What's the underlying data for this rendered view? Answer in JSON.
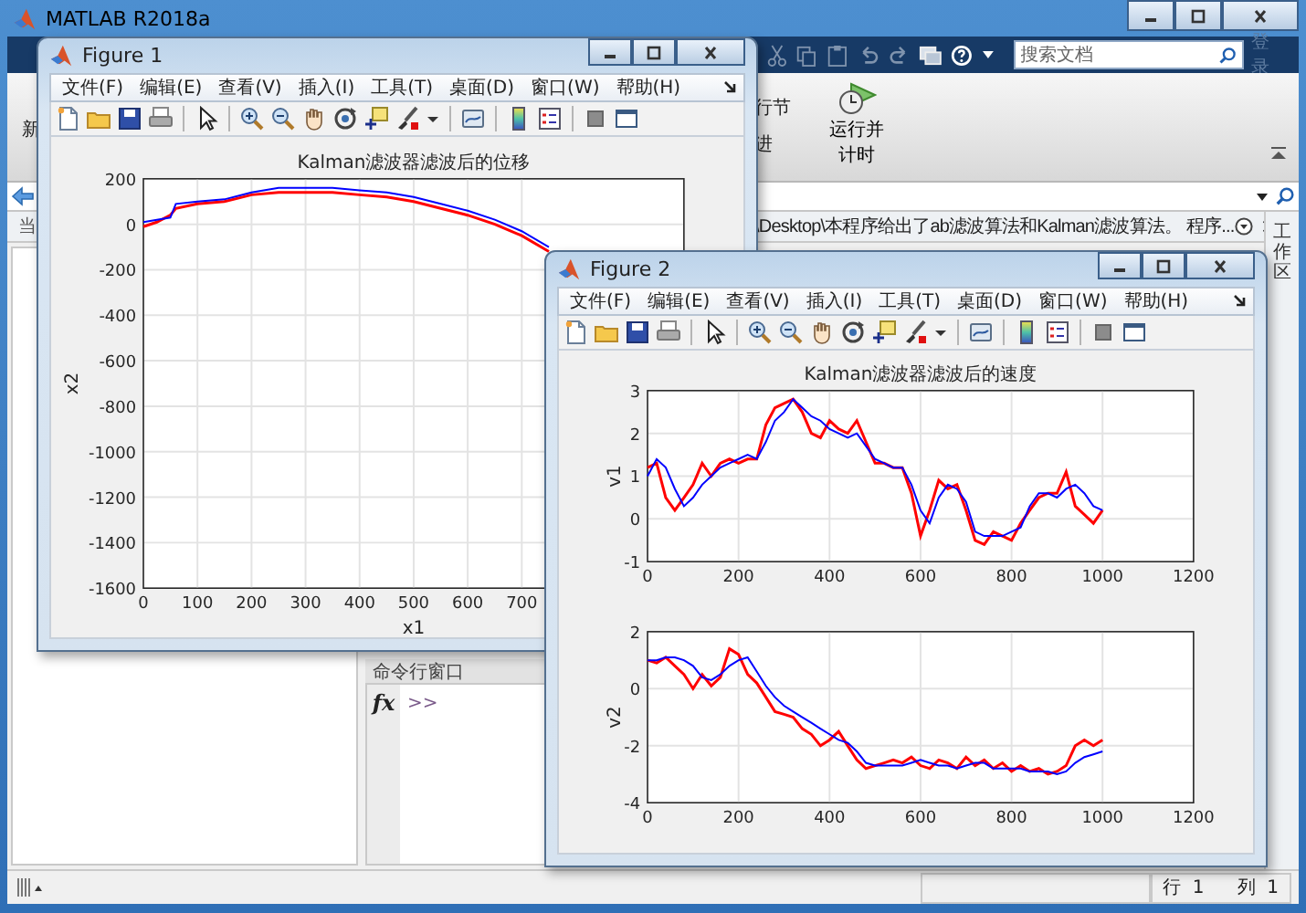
{
  "main_window": {
    "title": "MATLAB R2018a"
  },
  "quick_access": {
    "search": {
      "placeholder": "搜索文档"
    },
    "sign_in": "登录"
  },
  "ribbon": {
    "left_label": "新",
    "section_labels": [
      "行节",
      "进"
    ],
    "run_and_time": [
      "运行并",
      "计时"
    ]
  },
  "current_folder": {
    "label": "当",
    "path": "\\Desktop\\本程序给出了ab滤波算法和Kalman滤波算法。 程序..."
  },
  "workspace_panel": {
    "title": "工作区"
  },
  "command_window": {
    "title": "命令行窗口",
    "function_hint": "fx",
    "prompt": ">>"
  },
  "status_bar": [
    {
      "label": "行",
      "value": "1"
    },
    {
      "label": "列",
      "value": "1"
    }
  ],
  "figures": [
    {
      "title": "Figure 1",
      "menu": [
        "文件(F)",
        "编辑(E)",
        "查看(V)",
        "插入(I)",
        "工具(T)",
        "桌面(D)",
        "窗口(W)",
        "帮助(H)"
      ],
      "axes": [
        {
          "chart_data": {
            "type": "line",
            "title": "Kalman滤波器滤波后的位移",
            "xlabel": "x1",
            "ylabel": "x2",
            "x": [
              0,
              25,
              50,
              60,
              100,
              150,
              200,
              250,
              300,
              350,
              400,
              450,
              500,
              550,
              600,
              650,
              700,
              750
            ],
            "series": [
              {
                "color": "#ff0000",
                "values": [
                  -10,
                  10,
                  40,
                  70,
                  90,
                  100,
                  130,
                  140,
                  140,
                  140,
                  130,
                  120,
                  100,
                  70,
                  40,
                  0,
                  -50,
                  -120
                ]
              },
              {
                "color": "#0000ff",
                "values": [
                  10,
                  20,
                  30,
                  90,
                  100,
                  110,
                  140,
                  160,
                  160,
                  160,
                  150,
                  140,
                  120,
                  90,
                  60,
                  20,
                  -30,
                  -100
                ]
              }
            ],
            "grid": true,
            "xlim": [
              0,
              1000
            ],
            "ylim": [
              -1600,
              200
            ],
            "xticks": [
              0,
              100,
              200,
              300,
              400,
              500,
              600,
              700
            ],
            "yticks": [
              -1600,
              -1400,
              -1200,
              -1000,
              -800,
              -600,
              -400,
              -200,
              0,
              200
            ]
          }
        }
      ]
    },
    {
      "title": "Figure 2",
      "menu": [
        "文件(F)",
        "编辑(E)",
        "查看(V)",
        "插入(I)",
        "工具(T)",
        "桌面(D)",
        "窗口(W)",
        "帮助(H)"
      ],
      "axes": [
        {
          "chart_data": {
            "type": "line",
            "title": "Kalman滤波器滤波后的速度",
            "ylabel": "v1",
            "x": [
              0,
              20,
              40,
              60,
              80,
              100,
              120,
              140,
              160,
              180,
              200,
              220,
              240,
              260,
              280,
              300,
              320,
              340,
              360,
              380,
              400,
              420,
              440,
              460,
              480,
              500,
              520,
              540,
              560,
              580,
              600,
              620,
              640,
              660,
              680,
              700,
              720,
              740,
              760,
              780,
              800,
              820,
              840,
              860,
              880,
              900,
              920,
              940,
              960,
              980,
              1000
            ],
            "series": [
              {
                "color": "#ff0000",
                "values": [
                  1.2,
                  1.3,
                  0.5,
                  0.2,
                  0.5,
                  0.8,
                  1.3,
                  1.0,
                  1.3,
                  1.4,
                  1.3,
                  1.4,
                  1.4,
                  2.2,
                  2.6,
                  2.7,
                  2.8,
                  2.5,
                  2.0,
                  1.9,
                  2.3,
                  2.1,
                  2.0,
                  2.3,
                  1.8,
                  1.3,
                  1.3,
                  1.2,
                  1.2,
                  0.6,
                  -0.4,
                  0.2,
                  0.9,
                  0.7,
                  0.8,
                  0.2,
                  -0.5,
                  -0.6,
                  -0.3,
                  -0.4,
                  -0.5,
                  -0.1,
                  0.2,
                  0.5,
                  0.6,
                  0.6,
                  1.1,
                  0.3,
                  0.1,
                  -0.1,
                  0.2
                ]
              },
              {
                "color": "#0000ff",
                "values": [
                  1.0,
                  1.4,
                  1.2,
                  0.7,
                  0.3,
                  0.5,
                  0.8,
                  1.0,
                  1.2,
                  1.3,
                  1.4,
                  1.5,
                  1.4,
                  1.8,
                  2.3,
                  2.5,
                  2.8,
                  2.6,
                  2.4,
                  2.3,
                  2.1,
                  2.0,
                  1.9,
                  2.0,
                  1.7,
                  1.4,
                  1.3,
                  1.2,
                  1.2,
                  0.8,
                  0.2,
                  -0.1,
                  0.5,
                  0.8,
                  0.7,
                  0.4,
                  -0.3,
                  -0.4,
                  -0.4,
                  -0.4,
                  -0.3,
                  -0.2,
                  0.3,
                  0.6,
                  0.6,
                  0.5,
                  0.7,
                  0.8,
                  0.6,
                  0.3,
                  0.2
                ]
              }
            ],
            "grid": true,
            "xlim": [
              0,
              1200
            ],
            "ylim": [
              -1,
              3
            ],
            "xticks": [
              0,
              200,
              400,
              600,
              800,
              1000,
              1200
            ],
            "yticks": [
              -1,
              0,
              1,
              2,
              3
            ]
          }
        },
        {
          "chart_data": {
            "type": "line",
            "ylabel": "v2",
            "x": [
              0,
              20,
              40,
              60,
              80,
              100,
              120,
              140,
              160,
              180,
              200,
              220,
              240,
              260,
              280,
              300,
              320,
              340,
              360,
              380,
              400,
              420,
              440,
              460,
              480,
              500,
              520,
              540,
              560,
              580,
              600,
              620,
              640,
              660,
              680,
              700,
              720,
              740,
              760,
              780,
              800,
              820,
              840,
              860,
              880,
              900,
              920,
              940,
              960,
              980,
              1000
            ],
            "series": [
              {
                "color": "#ff0000",
                "values": [
                  1.0,
                  0.9,
                  1.1,
                  0.8,
                  0.5,
                  0.0,
                  0.5,
                  0.1,
                  0.4,
                  1.4,
                  1.2,
                  0.5,
                  0.2,
                  -0.3,
                  -0.8,
                  -0.9,
                  -1.0,
                  -1.4,
                  -1.6,
                  -2.0,
                  -1.8,
                  -1.5,
                  -2.0,
                  -2.5,
                  -2.8,
                  -2.7,
                  -2.6,
                  -2.5,
                  -2.6,
                  -2.4,
                  -2.7,
                  -2.8,
                  -2.5,
                  -2.6,
                  -2.8,
                  -2.4,
                  -2.7,
                  -2.5,
                  -2.8,
                  -2.6,
                  -2.9,
                  -2.7,
                  -2.9,
                  -2.8,
                  -3.0,
                  -2.9,
                  -2.7,
                  -2.0,
                  -1.8,
                  -2.0,
                  -1.8
                ]
              },
              {
                "color": "#0000ff",
                "values": [
                  1.0,
                  1.0,
                  1.1,
                  1.1,
                  1.0,
                  0.8,
                  0.4,
                  0.3,
                  0.5,
                  0.8,
                  1.0,
                  1.1,
                  0.6,
                  0.1,
                  -0.3,
                  -0.6,
                  -0.8,
                  -1.0,
                  -1.2,
                  -1.4,
                  -1.6,
                  -1.8,
                  -1.9,
                  -2.2,
                  -2.6,
                  -2.7,
                  -2.7,
                  -2.7,
                  -2.7,
                  -2.6,
                  -2.5,
                  -2.6,
                  -2.7,
                  -2.7,
                  -2.8,
                  -2.7,
                  -2.6,
                  -2.6,
                  -2.8,
                  -2.8,
                  -2.8,
                  -2.8,
                  -2.9,
                  -2.9,
                  -2.9,
                  -3.0,
                  -2.9,
                  -2.6,
                  -2.4,
                  -2.3,
                  -2.2
                ]
              }
            ],
            "grid": true,
            "xlim": [
              0,
              1200
            ],
            "ylim": [
              -4,
              2
            ],
            "xticks": [
              0,
              200,
              400,
              600,
              800,
              1000,
              1200
            ],
            "yticks": [
              -4,
              -2,
              0,
              2
            ]
          }
        }
      ]
    }
  ]
}
